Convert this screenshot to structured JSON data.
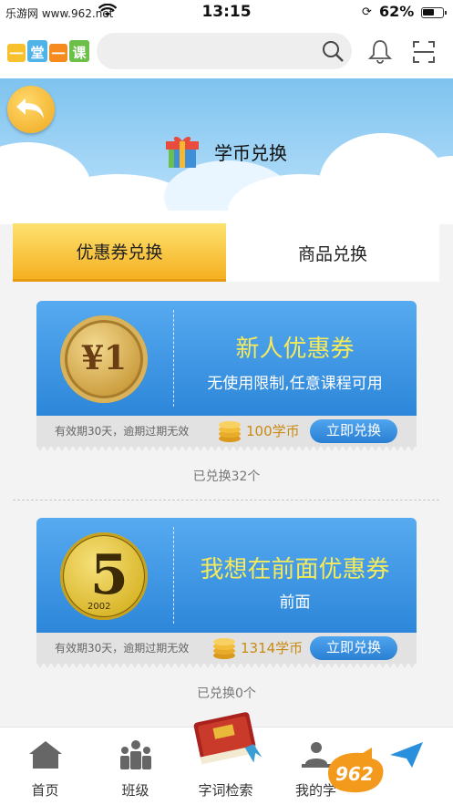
{
  "status_bar": {
    "site": "乐游网 www.962.net",
    "time": "13:15",
    "battery": "62%",
    "battery_level": 0.62
  },
  "header": {
    "logo_text": "一堂一课",
    "search_placeholder": "",
    "icons": [
      "search-icon",
      "bell-icon",
      "scan-icon"
    ]
  },
  "banner": {
    "title": "学币兑换",
    "back_icon": "back-arrow-icon",
    "gift_icon": "gift-icon"
  },
  "tabs": [
    {
      "label": "优惠券兑换",
      "active": true
    },
    {
      "label": "商品兑换",
      "active": false
    }
  ],
  "coupons": [
    {
      "coin_text": "¥1",
      "title": "新人优惠券",
      "description": "无使用限制,任意课程可用",
      "validity": "有效期30天，逾期过期无效",
      "price": "100学币",
      "button": "立即兑换",
      "redeemed": "已兑换32个"
    },
    {
      "coin_text": "5",
      "coin_year": "2002",
      "title": "我想在前面优惠券",
      "description": "前面",
      "validity": "有效期30天，逾期过期无效",
      "price": "1314学币",
      "button": "立即兑换",
      "redeemed": "已兑换0个"
    }
  ],
  "bottom_nav": [
    {
      "label": "首页",
      "icon": "home-icon"
    },
    {
      "label": "班级",
      "icon": "class-icon"
    },
    {
      "label": "字词检索",
      "icon": "dictionary-icon"
    },
    {
      "label": "我的学",
      "icon": "study-icon"
    },
    {
      "label": "",
      "icon": "send-icon"
    }
  ],
  "watermark": "962.net 乐游网",
  "colors": {
    "tab_active": "#f5b021",
    "coupon_blue": "#2d86d9",
    "coupon_title": "#f6ea5b",
    "price": "#c98a10"
  }
}
